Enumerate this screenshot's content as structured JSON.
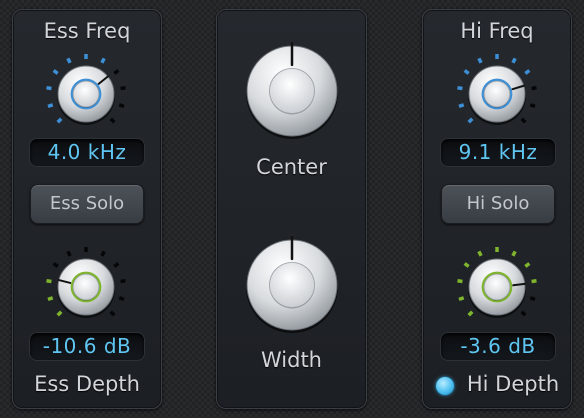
{
  "ess_panel": {
    "freq_label": "Ess Freq",
    "freq_value": "4.0 kHz",
    "solo_label": "Ess Solo",
    "depth_value": "-10.6 dB",
    "depth_label": "Ess Depth"
  },
  "center_panel": {
    "center_label": "Center",
    "width_label": "Width"
  },
  "hi_panel": {
    "freq_label": "Hi Freq",
    "freq_value": "9.1 kHz",
    "solo_label": "Hi Solo",
    "depth_value": "-3.6 dB",
    "depth_label": "Hi Depth"
  },
  "knobs": {
    "ess_freq": {
      "value": 0.69,
      "ring": "blue"
    },
    "ess_depth": {
      "value": 0.22,
      "ring": "green"
    },
    "center": {
      "value": 0.5,
      "ring": "none"
    },
    "width": {
      "value": 0.5,
      "ring": "none"
    },
    "hi_freq": {
      "value": 0.77,
      "ring": "blue"
    },
    "hi_depth": {
      "value": 0.81,
      "ring": "green"
    }
  },
  "colors": {
    "readout_text": "#5fc6f2",
    "blue_ring": "#3d8fd6",
    "green_ring": "#7fb52e",
    "inactive_tick": "#050607",
    "led": "#4cbff0"
  }
}
